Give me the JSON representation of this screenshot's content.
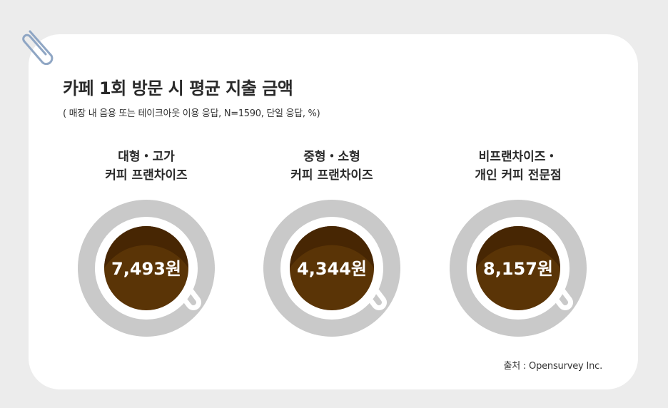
{
  "header": {
    "title": "카페 1회 방문 시 평균 지출 금액",
    "subtitle": "( 매장 내 음용 또는 테이크아웃 이용 응답, N=1590, 단일 응답, %)"
  },
  "chart_data": {
    "type": "bar",
    "title": "카페 1회 방문 시 평균 지출 금액",
    "subtitle": "( 매장 내 음용 또는 테이크아웃 이용 응답, N=1590, 단일 응답, %)",
    "categories": [
      [
        "대형・고가",
        "커피 프랜차이즈"
      ],
      [
        "중형・소형",
        "커피 프랜차이즈"
      ],
      [
        "비프랜차이즈・",
        "개인 커피 전문점"
      ]
    ],
    "values": [
      7493,
      4344,
      8157
    ],
    "value_labels": [
      "7,493원",
      "4,344원",
      "8,157원"
    ],
    "unit": "원"
  },
  "footer": {
    "source": "출처 : Opensurvey Inc."
  },
  "colors": {
    "background": "#ececec",
    "card": "#ffffff",
    "saucer": "#c9c9c9",
    "cup": "#ffffff",
    "coffee": "#5a3406",
    "coffee_shadow": "#472603",
    "label_text": "#ffffff"
  }
}
